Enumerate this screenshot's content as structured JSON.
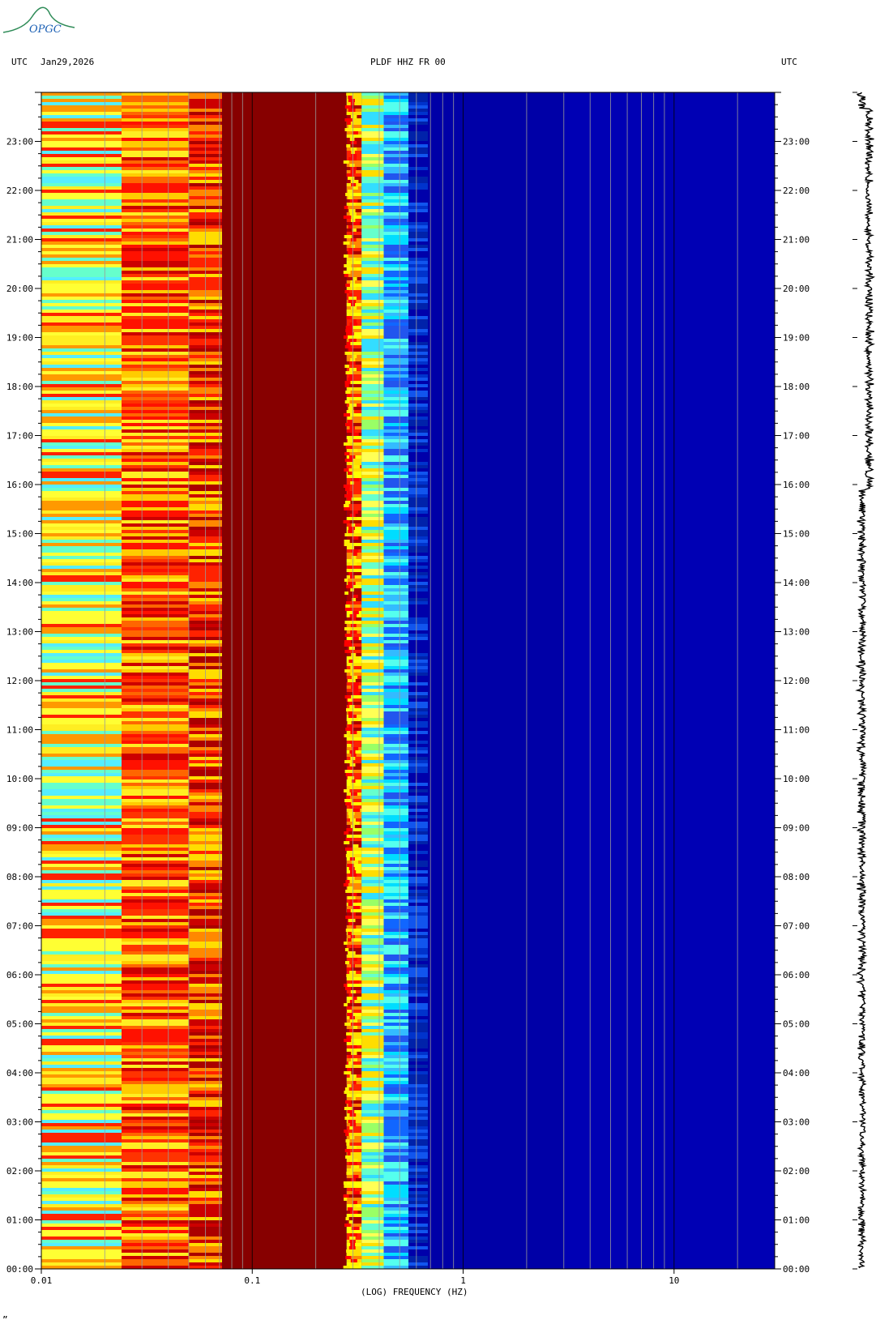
{
  "logo": {
    "text": "OPGC",
    "color": "#2e8b57"
  },
  "header": {
    "left_utc": "UTC",
    "date": "Jan29,2026",
    "station": "PLDF HHZ FR 00",
    "right_utc": "UTC"
  },
  "chart_data": {
    "type": "heatmap",
    "title": "PLDF HHZ FR 00",
    "xlabel": "(LOG) FREQUENCY (HZ)",
    "x_scale": "log",
    "xlim": [
      0.01,
      30
    ],
    "x_ticks": [
      {
        "value": 0.01,
        "label": "0.01"
      },
      {
        "value": 0.1,
        "label": "0.1"
      },
      {
        "value": 1,
        "label": "1"
      },
      {
        "value": 10,
        "label": "10"
      }
    ],
    "y_unit": "UTC hours",
    "ylim": [
      0,
      24
    ],
    "y_ticks": [
      "00:00",
      "01:00",
      "02:00",
      "03:00",
      "04:00",
      "05:00",
      "06:00",
      "07:00",
      "08:00",
      "09:00",
      "10:00",
      "11:00",
      "12:00",
      "13:00",
      "14:00",
      "15:00",
      "16:00",
      "17:00",
      "18:00",
      "19:00",
      "20:00",
      "21:00",
      "22:00",
      "23:00"
    ],
    "colormap": [
      "#00008b",
      "#0000cd",
      "#1e90ff",
      "#00ffff",
      "#ffff00",
      "#ffa500",
      "#ff0000",
      "#8b0000"
    ],
    "bands": [
      {
        "f_start": 0.01,
        "f_end": 0.024,
        "dominant": "yellow/cyan"
      },
      {
        "f_start": 0.024,
        "f_end": 0.05,
        "dominant": "orange/red"
      },
      {
        "f_start": 0.05,
        "f_end": 0.072,
        "dominant": "red/orange"
      },
      {
        "f_start": 0.072,
        "f_end": 0.28,
        "dominant": "dark red"
      },
      {
        "f_start": 0.28,
        "f_end": 0.65,
        "dominant": "yellow to cyan to blue transition"
      },
      {
        "f_start": 0.65,
        "f_end": 30,
        "dominant": "dark blue"
      }
    ],
    "seismogram": {
      "position": "right",
      "description": "vertical waveform trace, 00:00-24:00"
    }
  },
  "footer": {
    "mark": "”"
  }
}
